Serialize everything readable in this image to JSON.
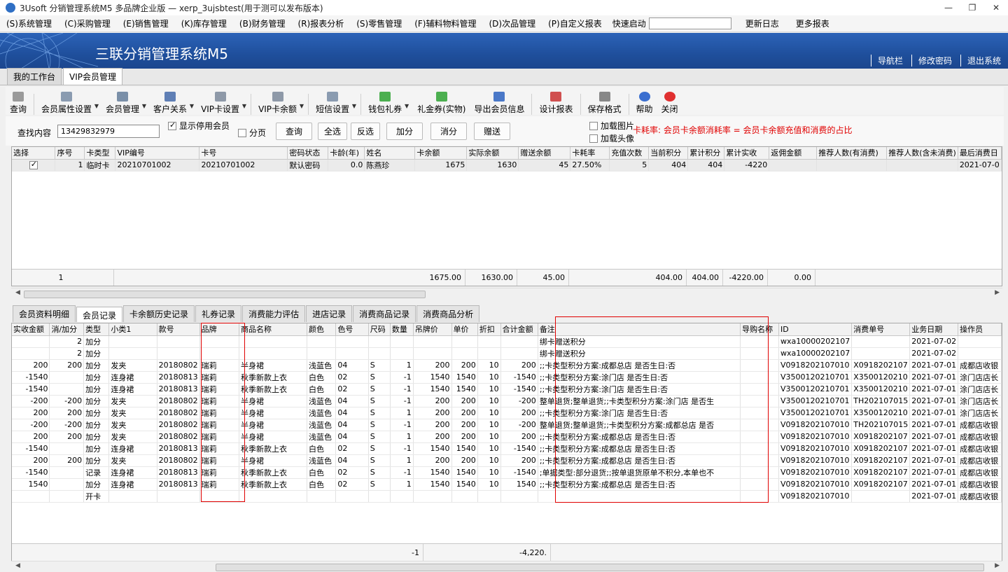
{
  "window": {
    "title": "3Usoft 分销管理系统M5 多品牌企业版 — xerp_3ujsbtest(用于测可以发布版本)"
  },
  "menu": {
    "items": [
      "(S)系统管理",
      "(C)采购管理",
      "(E)销售管理",
      "(K)库存管理",
      "(B)财务管理",
      "(R)报表分析",
      "(S)零售管理",
      "(F)辅料物料管理",
      "(D)次品管理",
      "(P)自定义报表"
    ],
    "quick_label": "快速启动",
    "quick_value": "",
    "right": [
      "更新日志",
      "更多报表"
    ]
  },
  "banner": {
    "brand": "三联分销管理系统M5",
    "links": [
      "导航栏",
      "修改密码",
      "退出系统"
    ]
  },
  "tabs": [
    "我的工作台",
    "VIP会员管理"
  ],
  "toolbar": {
    "items": [
      "查询",
      "会员属性设置",
      "会员管理",
      "客户关系",
      "VIP卡设置",
      "VIP卡余额",
      "短信设置",
      "钱包礼券",
      "礼金券(实物)",
      "导出会员信息",
      "设计报表",
      "保存格式",
      "帮助",
      "关闭"
    ]
  },
  "filter": {
    "search_label": "查找内容",
    "search_value": "13429832979",
    "show_disabled": "显示停用会员",
    "paging": "分页",
    "buttons": [
      "查询",
      "全选",
      "反选",
      "加分",
      "消分",
      "赠送"
    ],
    "load_image": "加载图片",
    "load_avatar": "加载头像",
    "note": "卡耗率: 会员卡余额消耗率 =  会员卡余额充值和消费的占比"
  },
  "member_grid": {
    "headers": [
      "选择",
      "序号",
      "卡类型",
      "VIP编号",
      "卡号",
      "密码状态",
      "卡龄(年)",
      "姓名",
      "卡余额",
      "实际余额",
      "赠送余额",
      "卡耗率",
      "充值次数",
      "当前积分",
      "累计积分",
      "累计实收",
      "返佣金额",
      "推荐人数(有消费)",
      "推荐人数(含未消费)",
      "最后消费日"
    ],
    "rows": [
      [
        "",
        "1",
        "临时卡",
        "20210701002",
        "20210701002",
        "默认密码",
        "0.0",
        "陈燕珍",
        "1675",
        "1630",
        "45",
        "27.50%",
        "5",
        "404",
        "404",
        "-4220",
        "",
        "",
        "",
        "2021-07-0"
      ]
    ],
    "totals": [
      "1",
      "1675.00",
      "1630.00",
      "45.00",
      "404.00",
      "404.00",
      "-4220.00",
      "0.00"
    ]
  },
  "subtabs": [
    "会员资料明细",
    "会员记录",
    "卡余额历史记录",
    "礼券记录",
    "消费能力评估",
    "进店记录",
    "消费商品记录",
    "消费商品分析"
  ],
  "record_grid": {
    "headers": [
      "实收金额",
      "消/加分",
      "类型",
      "小类1",
      "款号",
      "品牌",
      "商品名称",
      "颜色",
      "色号",
      "尺码",
      "数量",
      "吊牌价",
      "单价",
      "折扣",
      "合计金额",
      "备注",
      "导购名称",
      "ID",
      "消费单号",
      "业务日期",
      "操作员"
    ],
    "rows": [
      [
        "",
        "2",
        "加分",
        "",
        "",
        "",
        "",
        "",
        "",
        "",
        "",
        "",
        "",
        "",
        "",
        "绑卡赠送积分",
        "",
        "wxa10000202107",
        "",
        "2021-07-02",
        ""
      ],
      [
        "",
        "2",
        "加分",
        "",
        "",
        "",
        "",
        "",
        "",
        "",
        "",
        "",
        "",
        "",
        "",
        "绑卡赠送积分",
        "",
        "wxa10000202107",
        "",
        "2021-07-02",
        ""
      ],
      [
        "200",
        "200",
        "加分",
        "发夹",
        "20180802",
        "瑞莉",
        "半身裙",
        "浅蓝色",
        "04",
        "S",
        "1",
        "200",
        "200",
        "10",
        "200",
        ";;卡类型积分方案:成都总店 是否生日:否",
        "",
        "V0918202107010",
        "X0918202107",
        "2021-07-01",
        "成都店收银"
      ],
      [
        "-1540",
        "",
        "加分",
        "连身裙",
        "20180813",
        "瑞莉",
        "秋季新款上衣",
        "白色",
        "02",
        "S",
        "-1",
        "1540",
        "1540",
        "10",
        "-1540",
        ";;卡类型积分方案:涂门店 是否生日:否",
        "",
        "V3500120210701",
        "X3500120210",
        "2021-07-01",
        "涂门店店长"
      ],
      [
        "-1540",
        "",
        "加分",
        "连身裙",
        "20180813",
        "瑞莉",
        "秋季新款上衣",
        "白色",
        "02",
        "S",
        "-1",
        "1540",
        "1540",
        "10",
        "-1540",
        ";;卡类型积分方案:涂门店 是否生日:否",
        "",
        "V3500120210701",
        "X3500120210",
        "2021-07-01",
        "涂门店店长"
      ],
      [
        "-200",
        "-200",
        "加分",
        "发夹",
        "20180802",
        "瑞莉",
        "半身裙",
        "浅蓝色",
        "04",
        "S",
        "-1",
        "200",
        "200",
        "10",
        "-200",
        "整单退货;整单退货;;卡类型积分方案:涂门店 是否生",
        "",
        "V3500120210701",
        "TH202107015",
        "2021-07-01",
        "涂门店店长"
      ],
      [
        "200",
        "200",
        "加分",
        "发夹",
        "20180802",
        "瑞莉",
        "半身裙",
        "浅蓝色",
        "04",
        "S",
        "1",
        "200",
        "200",
        "10",
        "200",
        ";;卡类型积分方案:涂门店 是否生日:否",
        "",
        "V3500120210701",
        "X3500120210",
        "2021-07-01",
        "涂门店店长"
      ],
      [
        "-200",
        "-200",
        "加分",
        "发夹",
        "20180802",
        "瑞莉",
        "半身裙",
        "浅蓝色",
        "04",
        "S",
        "-1",
        "200",
        "200",
        "10",
        "-200",
        "整单退货;整单退货;;卡类型积分方案:成都总店 是否",
        "",
        "V0918202107010",
        "TH202107015",
        "2021-07-01",
        "成都店收银"
      ],
      [
        "200",
        "200",
        "加分",
        "发夹",
        "20180802",
        "瑞莉",
        "半身裙",
        "浅蓝色",
        "04",
        "S",
        "1",
        "200",
        "200",
        "10",
        "200",
        ";;卡类型积分方案:成都总店 是否生日:否",
        "",
        "V0918202107010",
        "X0918202107",
        "2021-07-01",
        "成都店收银"
      ],
      [
        "-1540",
        "",
        "加分",
        "连身裙",
        "20180813",
        "瑞莉",
        "秋季新款上衣",
        "白色",
        "02",
        "S",
        "-1",
        "1540",
        "1540",
        "10",
        "-1540",
        ";;卡类型积分方案:成都总店 是否生日:否",
        "",
        "V0918202107010",
        "X0918202107",
        "2021-07-01",
        "成都店收银"
      ],
      [
        "200",
        "200",
        "加分",
        "发夹",
        "20180802",
        "瑞莉",
        "半身裙",
        "浅蓝色",
        "04",
        "S",
        "1",
        "200",
        "200",
        "10",
        "200",
        ";;卡类型积分方案:成都总店 是否生日:否",
        "",
        "V0918202107010",
        "X0918202107",
        "2021-07-01",
        "成都店收银"
      ],
      [
        "-1540",
        "",
        "记录",
        "连身裙",
        "20180813",
        "瑞莉",
        "秋季新款上衣",
        "白色",
        "02",
        "S",
        "-1",
        "1540",
        "1540",
        "10",
        "-1540",
        ";单据类型:部分退货;;按单退货原单不积分,本单也不",
        "",
        "V0918202107010",
        "X0918202107",
        "2021-07-01",
        "成都店收银"
      ],
      [
        "1540",
        "",
        "加分",
        "连身裙",
        "20180813",
        "瑞莉",
        "秋季新款上衣",
        "白色",
        "02",
        "S",
        "1",
        "1540",
        "1540",
        "10",
        "1540",
        ";;卡类型积分方案:成都总店 是否生日:否",
        "",
        "V0918202107010",
        "X0918202107",
        "2021-07-01",
        "成都店收银"
      ],
      [
        "",
        "",
        "开卡",
        "",
        "",
        "",
        "",
        "",
        "",
        "",
        "",
        "",
        "",
        "",
        "",
        "",
        "",
        "V0918202107010",
        "",
        "2021-07-01",
        "成都店收银"
      ]
    ],
    "totals": [
      "-1",
      "-4,220."
    ]
  }
}
